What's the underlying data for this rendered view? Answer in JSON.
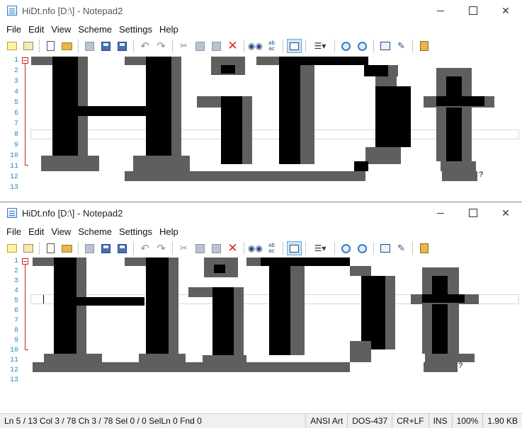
{
  "windows": [
    {
      "title": "HiDt.nfo [D:\\] - Notepad2",
      "menus": [
        "File",
        "Edit",
        "View",
        "Scheme",
        "Settings",
        "Help"
      ],
      "line_numbers": [
        "1",
        "2",
        "3",
        "4",
        "5",
        "6",
        "7",
        "8",
        "9",
        "10",
        "11",
        "12",
        "13"
      ],
      "trailing_char": "?"
    },
    {
      "title": "HiDt.nfo [D:\\] - Notepad2",
      "menus": [
        "File",
        "Edit",
        "View",
        "Scheme",
        "Settings",
        "Help"
      ],
      "line_numbers": [
        "1",
        "2",
        "3",
        "4",
        "5",
        "6",
        "7",
        "8",
        "9",
        "10",
        "11",
        "12",
        "13"
      ],
      "trailing_char": "?",
      "status": {
        "position": "Ln 5 / 13  Col 3 / 78  Ch 3 / 78  Sel 0 / 0  SelLn 0  Fnd 0",
        "scheme": "ANSI Art",
        "encoding": "DOS-437",
        "line_endings": "CR+LF",
        "mode": "INS",
        "zoom": "100%",
        "size": "1.90 KB"
      }
    }
  ],
  "toolbar_icons": [
    "scheme-icon",
    "find-file-icon",
    "new-file-icon",
    "open-folder-icon",
    "save-icon",
    "save-as-icon",
    "save-copy-icon",
    "undo-icon",
    "redo-icon",
    "cut-icon",
    "copy-icon",
    "paste-icon",
    "delete-icon",
    "find-icon",
    "replace-icon",
    "word-wrap-icon",
    "view-whitespace-icon",
    "zoom-in-icon",
    "zoom-out-icon",
    "settings-icon",
    "edit-scheme-icon",
    "exit-icon"
  ],
  "accent_colors": {
    "line_number": "#2a8ab5",
    "fold_marker": "#cc2222",
    "wrap_pressed": "#cce4f7"
  }
}
